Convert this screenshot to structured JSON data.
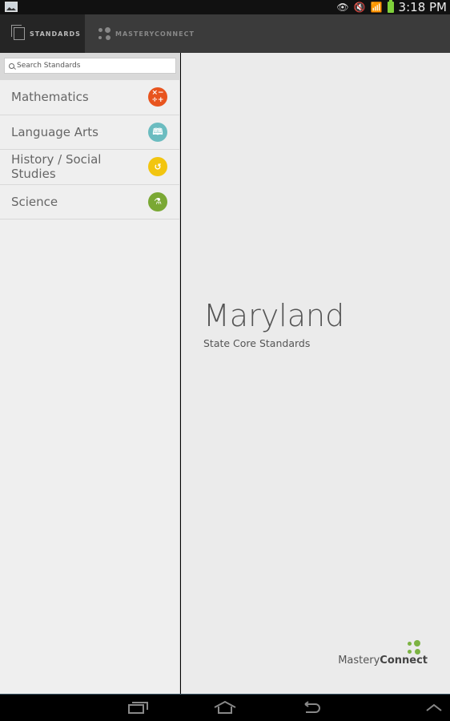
{
  "status_bar": {
    "time": "3:18 PM",
    "icons": [
      "gallery-icon",
      "eye-icon",
      "mute-icon",
      "wifi-icon",
      "battery-icon"
    ]
  },
  "tabs": [
    {
      "label": "STANDARDS",
      "icon": "documents-icon",
      "active": true
    },
    {
      "label": "MASTERYCONNECT",
      "icon": "masteryconnect-icon",
      "active": false
    }
  ],
  "sidebar": {
    "search_placeholder": "Search Standards",
    "search_value": "",
    "items": [
      {
        "label": "Mathematics",
        "icon": "math-operators-icon",
        "color": "#e8541e"
      },
      {
        "label": "Language Arts",
        "icon": "book-icon",
        "color": "#6bbcc0"
      },
      {
        "label": "History / Social Studies",
        "icon": "history-clock-icon",
        "color": "#f2c510"
      },
      {
        "label": "Science",
        "icon": "flask-icon",
        "color": "#7aa834"
      }
    ]
  },
  "main": {
    "title": "Maryland",
    "subtitle": "State Core Standards",
    "logo_light": "Mastery",
    "logo_bold": "Connect",
    "logo_color": "#7cb342"
  },
  "nav_bar": {
    "buttons": [
      "recent-apps-icon",
      "home-icon",
      "back-icon",
      "up-chevron-icon"
    ]
  }
}
